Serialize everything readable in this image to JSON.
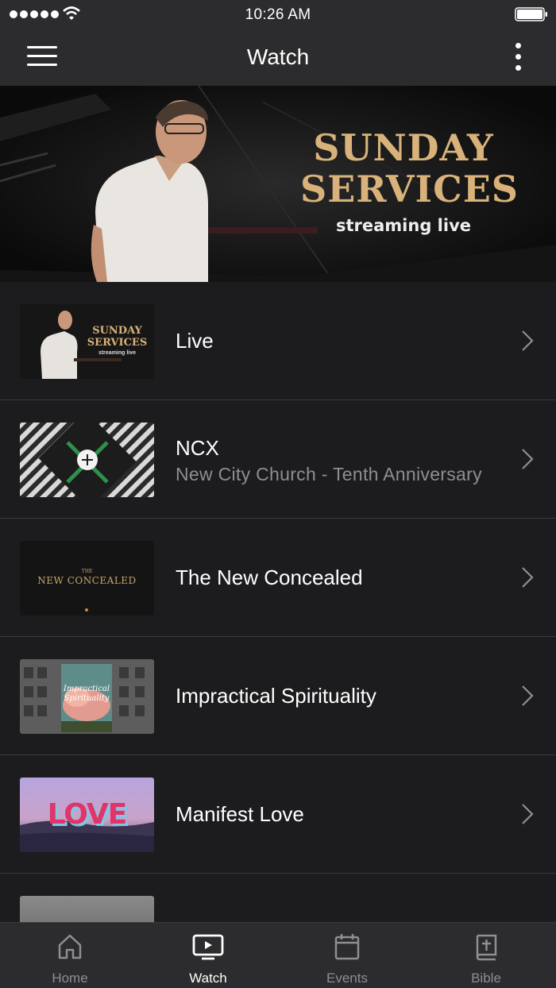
{
  "status_bar": {
    "time": "10:26 AM"
  },
  "nav": {
    "title": "Watch"
  },
  "hero": {
    "title_line1": "SUNDAY",
    "title_line2": "SERVICES",
    "subtitle": "streaming live"
  },
  "list": {
    "items": [
      {
        "title": "Live",
        "subtitle": "",
        "thumb_text_1": "SUNDAY",
        "thumb_text_2": "SERVICES",
        "thumb_text_3": "streaming live"
      },
      {
        "title": "NCX",
        "subtitle": "New City Church - Tenth Anniversary"
      },
      {
        "title": "The New Concealed",
        "subtitle": "",
        "thumb_text_1": "THE",
        "thumb_text_2": "NEW CONCEALED"
      },
      {
        "title": "Impractical Spirituality",
        "subtitle": "",
        "thumb_text_1": "Impractical",
        "thumb_text_2": "Spirituality"
      },
      {
        "title": "Manifest Love",
        "subtitle": "",
        "thumb_text_1": "LOVE"
      },
      {
        "title": "",
        "subtitle": ""
      }
    ]
  },
  "tabs": [
    {
      "label": "Home",
      "icon": "home-icon"
    },
    {
      "label": "Watch",
      "icon": "tv-icon",
      "active": true
    },
    {
      "label": "Events",
      "icon": "calendar-icon"
    },
    {
      "label": "Bible",
      "icon": "bible-icon"
    }
  ],
  "colors": {
    "accent_gold": "#d8b27a",
    "background": "#1c1c1e",
    "bar": "#2c2c2e",
    "love_pink": "#e0346a"
  }
}
